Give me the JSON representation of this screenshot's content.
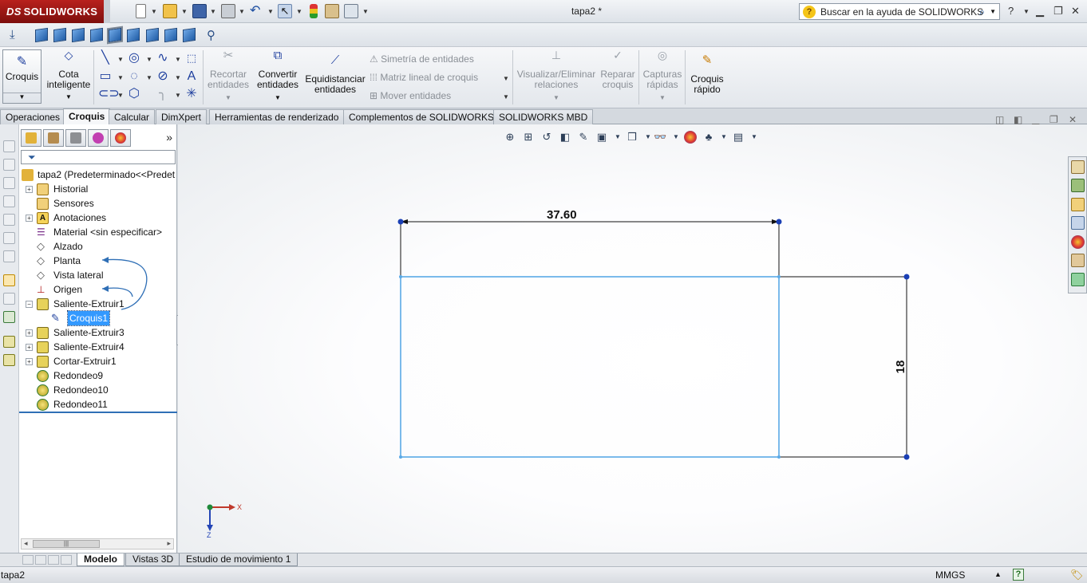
{
  "app": {
    "brand": "SOLIDWORKS",
    "brand_prefix": "DS",
    "document_title": "tapa2 *"
  },
  "help_search": {
    "placeholder": "Buscar en la ayuda de SOLIDWORKS"
  },
  "command_manager": {
    "sketch_button": "Croquis",
    "smart_dimension": [
      "Cota",
      "inteligente"
    ],
    "trim": [
      "Recortar",
      "entidades"
    ],
    "convert": [
      "Convertir",
      "entidades"
    ],
    "offset": [
      "Equidistanciar",
      "entidades"
    ],
    "mirror": "Simetría de entidades",
    "linear_pattern": "Matriz lineal de croquis",
    "move": "Mover entidades",
    "display_relations": [
      "Visualizar/Eliminar",
      "relaciones"
    ],
    "repair": [
      "Reparar",
      "croquis"
    ],
    "quick_snaps": [
      "Capturas",
      "rápidas"
    ],
    "rapid_sketch": [
      "Croquis",
      "rápido"
    ]
  },
  "tabs": [
    "Operaciones",
    "Croquis",
    "Calcular",
    "DimXpert",
    "Herramientas de renderizado",
    "Complementos de SOLIDWORKS",
    "SOLIDWORKS MBD"
  ],
  "active_tab": "Croquis",
  "feature_tree": {
    "root": "tapa2  (Predeterminado<<Predet",
    "items": [
      {
        "label": "Historial",
        "icon": "history-icon"
      },
      {
        "label": "Sensores",
        "icon": "sensor-icon"
      },
      {
        "label": "Anotaciones",
        "icon": "annotations-icon"
      },
      {
        "label": "Material <sin especificar>",
        "icon": "material-icon"
      },
      {
        "label": "Alzado",
        "icon": "plane-icon"
      },
      {
        "label": "Planta",
        "icon": "plane-icon"
      },
      {
        "label": "Vista lateral",
        "icon": "plane-icon"
      },
      {
        "label": "Origen",
        "icon": "origin-icon"
      },
      {
        "label": "Saliente-Extruir1",
        "icon": "extrude-icon"
      },
      {
        "label": "Croquis1",
        "icon": "sketch-icon",
        "selected": true
      },
      {
        "label": "Saliente-Extruir3",
        "icon": "extrude-icon"
      },
      {
        "label": "Saliente-Extruir4",
        "icon": "extrude-icon"
      },
      {
        "label": "Cortar-Extruir1",
        "icon": "cut-extrude-icon"
      },
      {
        "label": "Redondeo9",
        "icon": "fillet-icon"
      },
      {
        "label": "Redondeo10",
        "icon": "fillet-icon"
      },
      {
        "label": "Redondeo11",
        "icon": "fillet-icon"
      }
    ]
  },
  "sketch": {
    "horizontal_dimension": "37.60",
    "vertical_dimension": "18",
    "line_color": "#111111",
    "selected_color": "#5aa9e6",
    "point_color": "#1a3fb5"
  },
  "triad": {
    "x_label": "X",
    "z_label": "Z"
  },
  "bottom_tabs": [
    "Modelo",
    "Vistas 3D",
    "Estudio de movimiento 1"
  ],
  "active_bottom_tab": "Modelo",
  "status": {
    "document": "tapa2",
    "units": "MMGS"
  }
}
